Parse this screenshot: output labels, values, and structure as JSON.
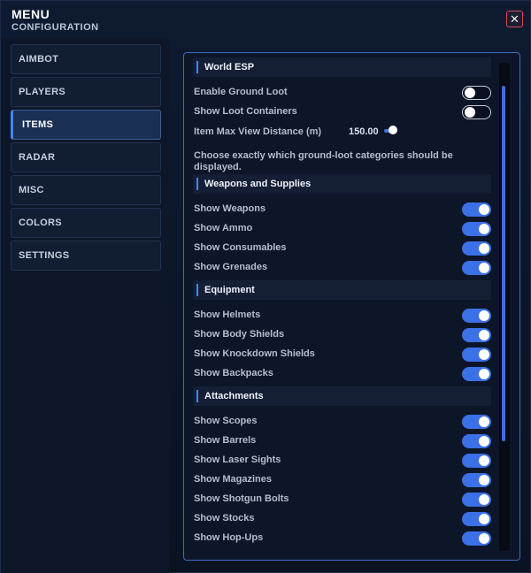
{
  "header": {
    "title": "MENU",
    "subtitle": "CONFIGURATION",
    "close_glyph": "✕"
  },
  "sidebar": {
    "items": [
      {
        "label": "AIMBOT",
        "active": false
      },
      {
        "label": "PLAYERS",
        "active": false
      },
      {
        "label": "ITEMS",
        "active": true
      },
      {
        "label": "RADAR",
        "active": false
      },
      {
        "label": "MISC",
        "active": false
      },
      {
        "label": "COLORS",
        "active": false
      },
      {
        "label": "SETTINGS",
        "active": false
      }
    ]
  },
  "panel": {
    "world_esp": {
      "title": "World ESP",
      "enable_ground_loot": {
        "label": "Enable Ground Loot",
        "on": false
      },
      "show_loot_containers": {
        "label": "Show Loot Containers",
        "on": false
      },
      "max_view_distance": {
        "label": "Item Max View Distance (m)",
        "value": "150.00"
      },
      "description": "Choose exactly which ground-loot categories should be displayed."
    },
    "weapons_supplies": {
      "title": "Weapons and Supplies",
      "items": [
        {
          "label": "Show Weapons",
          "on": true
        },
        {
          "label": "Show Ammo",
          "on": true
        },
        {
          "label": "Show Consumables",
          "on": true
        },
        {
          "label": "Show Grenades",
          "on": true
        }
      ]
    },
    "equipment": {
      "title": "Equipment",
      "items": [
        {
          "label": "Show Helmets",
          "on": true
        },
        {
          "label": "Show Body Shields",
          "on": true
        },
        {
          "label": "Show Knockdown Shields",
          "on": true
        },
        {
          "label": "Show Backpacks",
          "on": true
        }
      ]
    },
    "attachments": {
      "title": "Attachments",
      "items": [
        {
          "label": "Show Scopes",
          "on": true
        },
        {
          "label": "Show Barrels",
          "on": true
        },
        {
          "label": "Show Laser Sights",
          "on": true
        },
        {
          "label": "Show Magazines",
          "on": true
        },
        {
          "label": "Show Shotgun Bolts",
          "on": true
        },
        {
          "label": "Show Stocks",
          "on": true
        },
        {
          "label": "Show Hop-Ups",
          "on": true
        }
      ]
    }
  },
  "colors": {
    "accent": "#3b70e6",
    "close_border": "#d94a5a",
    "panel_border": "#3e6ac8"
  }
}
